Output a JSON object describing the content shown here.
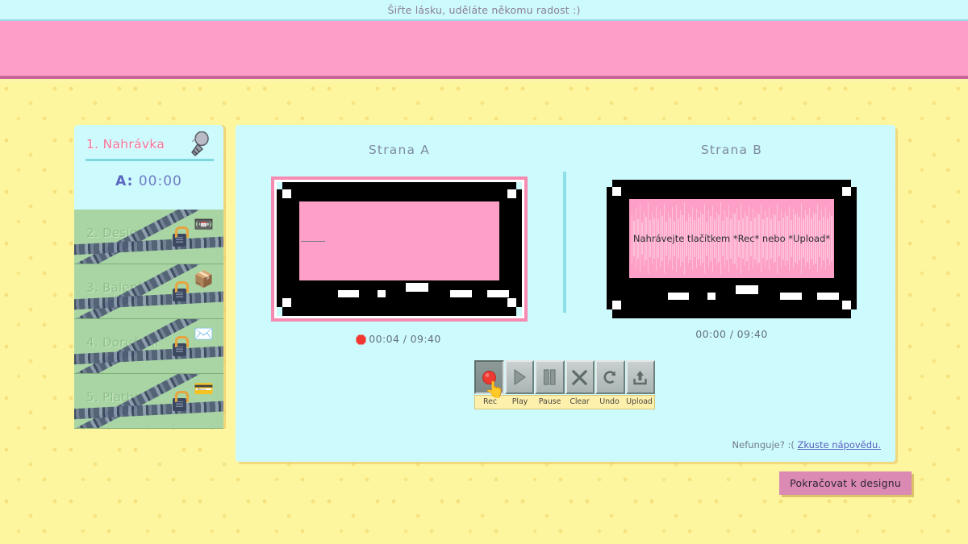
{
  "announce": {
    "text": "Šiřte lásku, uděláte někomu radost :)"
  },
  "sidebar": {
    "steps": [
      {
        "title": "1. Nahrávka",
        "state": "active",
        "icon": "microphone-icon",
        "emoji": "🎤"
      },
      {
        "title": "2. Design",
        "state": "locked",
        "icon": "cassette-icon",
        "emoji": "📼"
      },
      {
        "title": "3. Balení",
        "state": "locked",
        "icon": "package-icon",
        "emoji": "📦"
      },
      {
        "title": "4. Doručení",
        "state": "locked",
        "icon": "envelope-icon",
        "emoji": "✉️"
      },
      {
        "title": "5. Platba",
        "state": "locked",
        "icon": "wallet-icon",
        "emoji": "💳"
      }
    ],
    "timer_label": "A:",
    "timer_value": "00:00"
  },
  "recorder": {
    "side_a": {
      "title": "Strana A",
      "time": "00:04 / 09:40",
      "recording": true,
      "hint": ""
    },
    "side_b": {
      "title": "Strana B",
      "time": "00:00 / 09:40",
      "recording": false,
      "hint": "Nahrávejte tlačítkem *Rec* nebo *Upload*"
    },
    "transport": [
      {
        "label": "Rec",
        "icon": "record-icon",
        "state": "pressed"
      },
      {
        "label": "Play",
        "icon": "play-icon",
        "state": "normal"
      },
      {
        "label": "Pause",
        "icon": "pause-icon",
        "state": "normal"
      },
      {
        "label": "Clear",
        "icon": "close-x-icon",
        "state": "normal"
      },
      {
        "label": "Undo",
        "icon": "undo-icon",
        "state": "normal"
      },
      {
        "label": "Upload",
        "icon": "upload-icon",
        "state": "normal"
      }
    ],
    "help_text": "Nefunguje? :( ",
    "help_link": "Zkuste nápovědu."
  },
  "footer": {
    "continue_label": "Pokračovat k designu"
  },
  "colors": {
    "header_pink": "#fd9ec8",
    "header_border": "#c96398",
    "page_yellow": "#fdf69f",
    "panel_cyan": "#cdfafd",
    "locked_green": "#a8d5a3",
    "tape_pink": "#fe9fc8",
    "accent_link": "#5a5fbf",
    "rec_red": "#f1372f",
    "continue_mauve": "#da8ab3"
  }
}
